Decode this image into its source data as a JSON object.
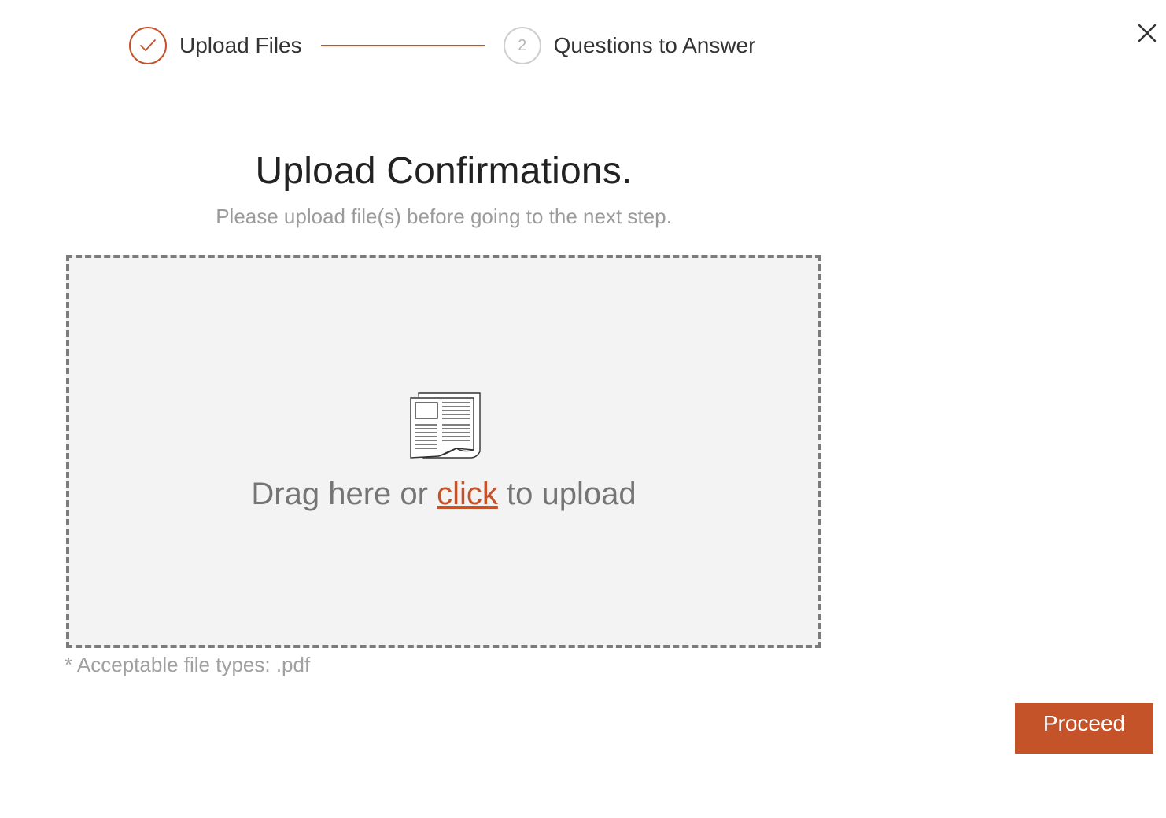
{
  "stepper": {
    "steps": [
      {
        "label": "Upload Files",
        "status": "completed",
        "icon": "check-icon"
      },
      {
        "label": "Questions to Answer",
        "status": "pending",
        "number": "2"
      }
    ]
  },
  "close": {
    "icon": "close-icon"
  },
  "header": {
    "title": "Upload Confirmations.",
    "subtitle": "Please upload file(s) before going to the next step."
  },
  "dropzone": {
    "icon": "document-icon",
    "text_before": "Drag here or ",
    "link_text": "click",
    "text_after": " to upload"
  },
  "note": "* Acceptable file types: .pdf",
  "actions": {
    "proceed_label": "Proceed"
  },
  "colors": {
    "accent": "#c4532a",
    "muted_text": "#9b9b9b",
    "dropzone_bg": "#f3f3f3",
    "dropzone_border": "#7b7b7b"
  }
}
